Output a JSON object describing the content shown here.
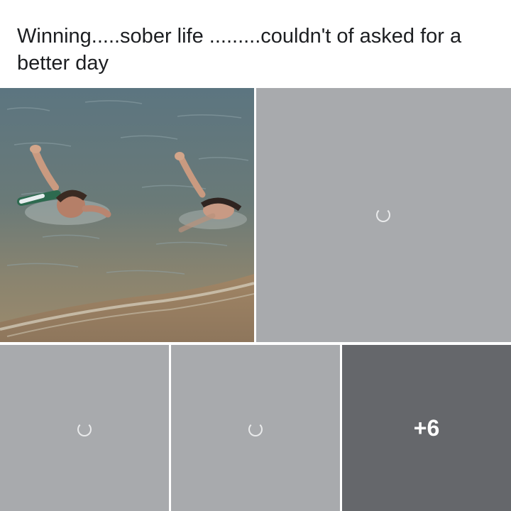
{
  "post": {
    "text": "Winning.....sober life .........couldn't of asked for a better day"
  },
  "media": {
    "photo_alt": "Two people swimming in the water near the shore",
    "more_count": "+6",
    "loading_icon": "loading-spinner-icon"
  },
  "colors": {
    "placeholder": "#a8aaad",
    "overlay": "#65676b",
    "text": "#1c1e21"
  }
}
